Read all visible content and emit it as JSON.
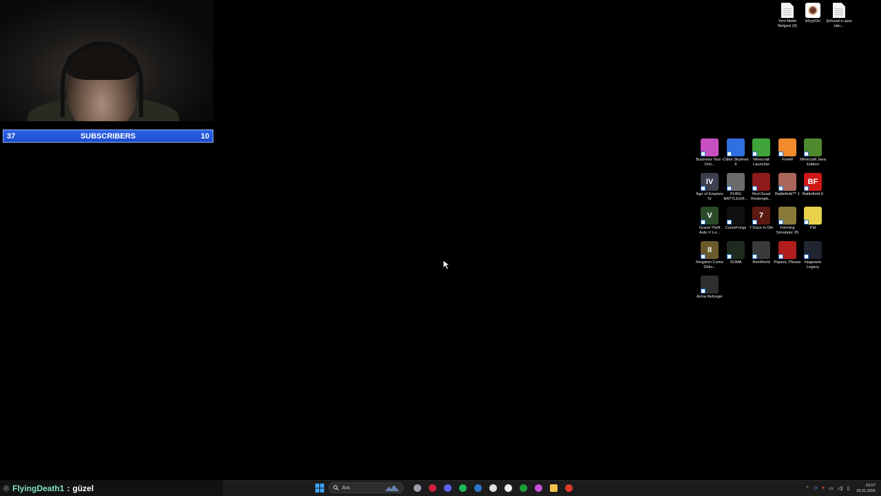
{
  "overlay": {
    "subscribers": {
      "left_count": "37",
      "label": "SUBSCRIBERS",
      "right_count": "10"
    }
  },
  "desktop": {
    "top_files": [
      {
        "label": "Yeni Metin Belgesi (3)",
        "icon": "text-document-icon"
      },
      {
        "label": "b5yy53n",
        "icon": "avatar-image-icon"
      },
      {
        "label": "Şehzad e-spor takı...",
        "icon": "text-document-icon"
      }
    ],
    "apps": [
      {
        "label": "Business Tour - Onli...",
        "icon": "business-tour-icon",
        "color": "#c84fc2",
        "glyph": ""
      },
      {
        "label": "Cities Skylines II",
        "icon": "cities-skylines-icon",
        "color": "#2f6fe0",
        "glyph": ""
      },
      {
        "label": "Minecraft Launcher",
        "icon": "minecraft-launcher-icon",
        "color": "#3fa33a",
        "glyph": ""
      },
      {
        "label": "FiveM",
        "icon": "fivem-icon",
        "color": "#f08a2c",
        "glyph": ""
      },
      {
        "label": "Minecraft Java Edition",
        "icon": "minecraft-java-icon",
        "color": "#4f8a2e",
        "glyph": ""
      },
      {
        "label": "Age of Empires IV",
        "icon": "age-of-empires-icon",
        "color": "#3b3f4e",
        "glyph": "IV"
      },
      {
        "label": "PUBG BATTLEGR...",
        "icon": "pubg-icon",
        "color": "#6b6b6b",
        "glyph": ""
      },
      {
        "label": "Red Dead Redempti...",
        "icon": "red-dead-icon",
        "color": "#8e1b1b",
        "glyph": ""
      },
      {
        "label": "Battlefield™ 1",
        "icon": "battlefield-1-icon",
        "color": "#a9665a",
        "glyph": ""
      },
      {
        "label": "Battlefield 6",
        "icon": "battlefield-6-icon",
        "color": "#d01818",
        "glyph": "BF"
      },
      {
        "label": "Grand Theft Auto V Le...",
        "icon": "gta-v-icon",
        "color": "#2a4a2a",
        "glyph": "V"
      },
      {
        "label": "CurseForge",
        "icon": "curseforge-icon",
        "color": "#111111",
        "glyph": ""
      },
      {
        "label": "7 Days to Die",
        "icon": "seven-days-icon",
        "color": "#5a1a12",
        "glyph": "7"
      },
      {
        "label": "Farming Simulator 25",
        "icon": "farming-simulator-icon",
        "color": "#8a7a3a",
        "glyph": ""
      },
      {
        "label": "Pal",
        "icon": "palworld-icon",
        "color": "#e8d24a",
        "glyph": ""
      },
      {
        "label": "Kingdom Come Deliv...",
        "icon": "kingdom-come-icon",
        "color": "#6a5a2a",
        "glyph": "II"
      },
      {
        "label": "SOMA",
        "icon": "soma-icon",
        "color": "#1f2a1f",
        "glyph": ""
      },
      {
        "label": "RimWorld",
        "icon": "rimworld-icon",
        "color": "#3a3a3a",
        "glyph": ""
      },
      {
        "label": "Papers, Please",
        "icon": "papers-please-icon",
        "color": "#b21e1e",
        "glyph": ""
      },
      {
        "label": "Hogwarts Legacy",
        "icon": "hogwarts-legacy-icon",
        "color": "#1e2530",
        "glyph": ""
      },
      {
        "label": "Arma Reforger",
        "icon": "arma-reforger-icon",
        "color": "#2e3030",
        "glyph": ""
      }
    ]
  },
  "chat": {
    "user": "FlyingDeath1",
    "separator": ":",
    "message": "güzel"
  },
  "taskbar": {
    "search_placeholder": "Ara",
    "pinned": [
      "file-explorer-view-icon",
      "opera-gx-icon",
      "discord-icon",
      "spotify-icon",
      "steam-icon",
      "epic-games-icon",
      "capcut-icon",
      "xbox-icon",
      "copilot-icon",
      "folder-icon",
      "rockstar-icon"
    ],
    "time": "03:57",
    "date": "20.01.2026"
  }
}
